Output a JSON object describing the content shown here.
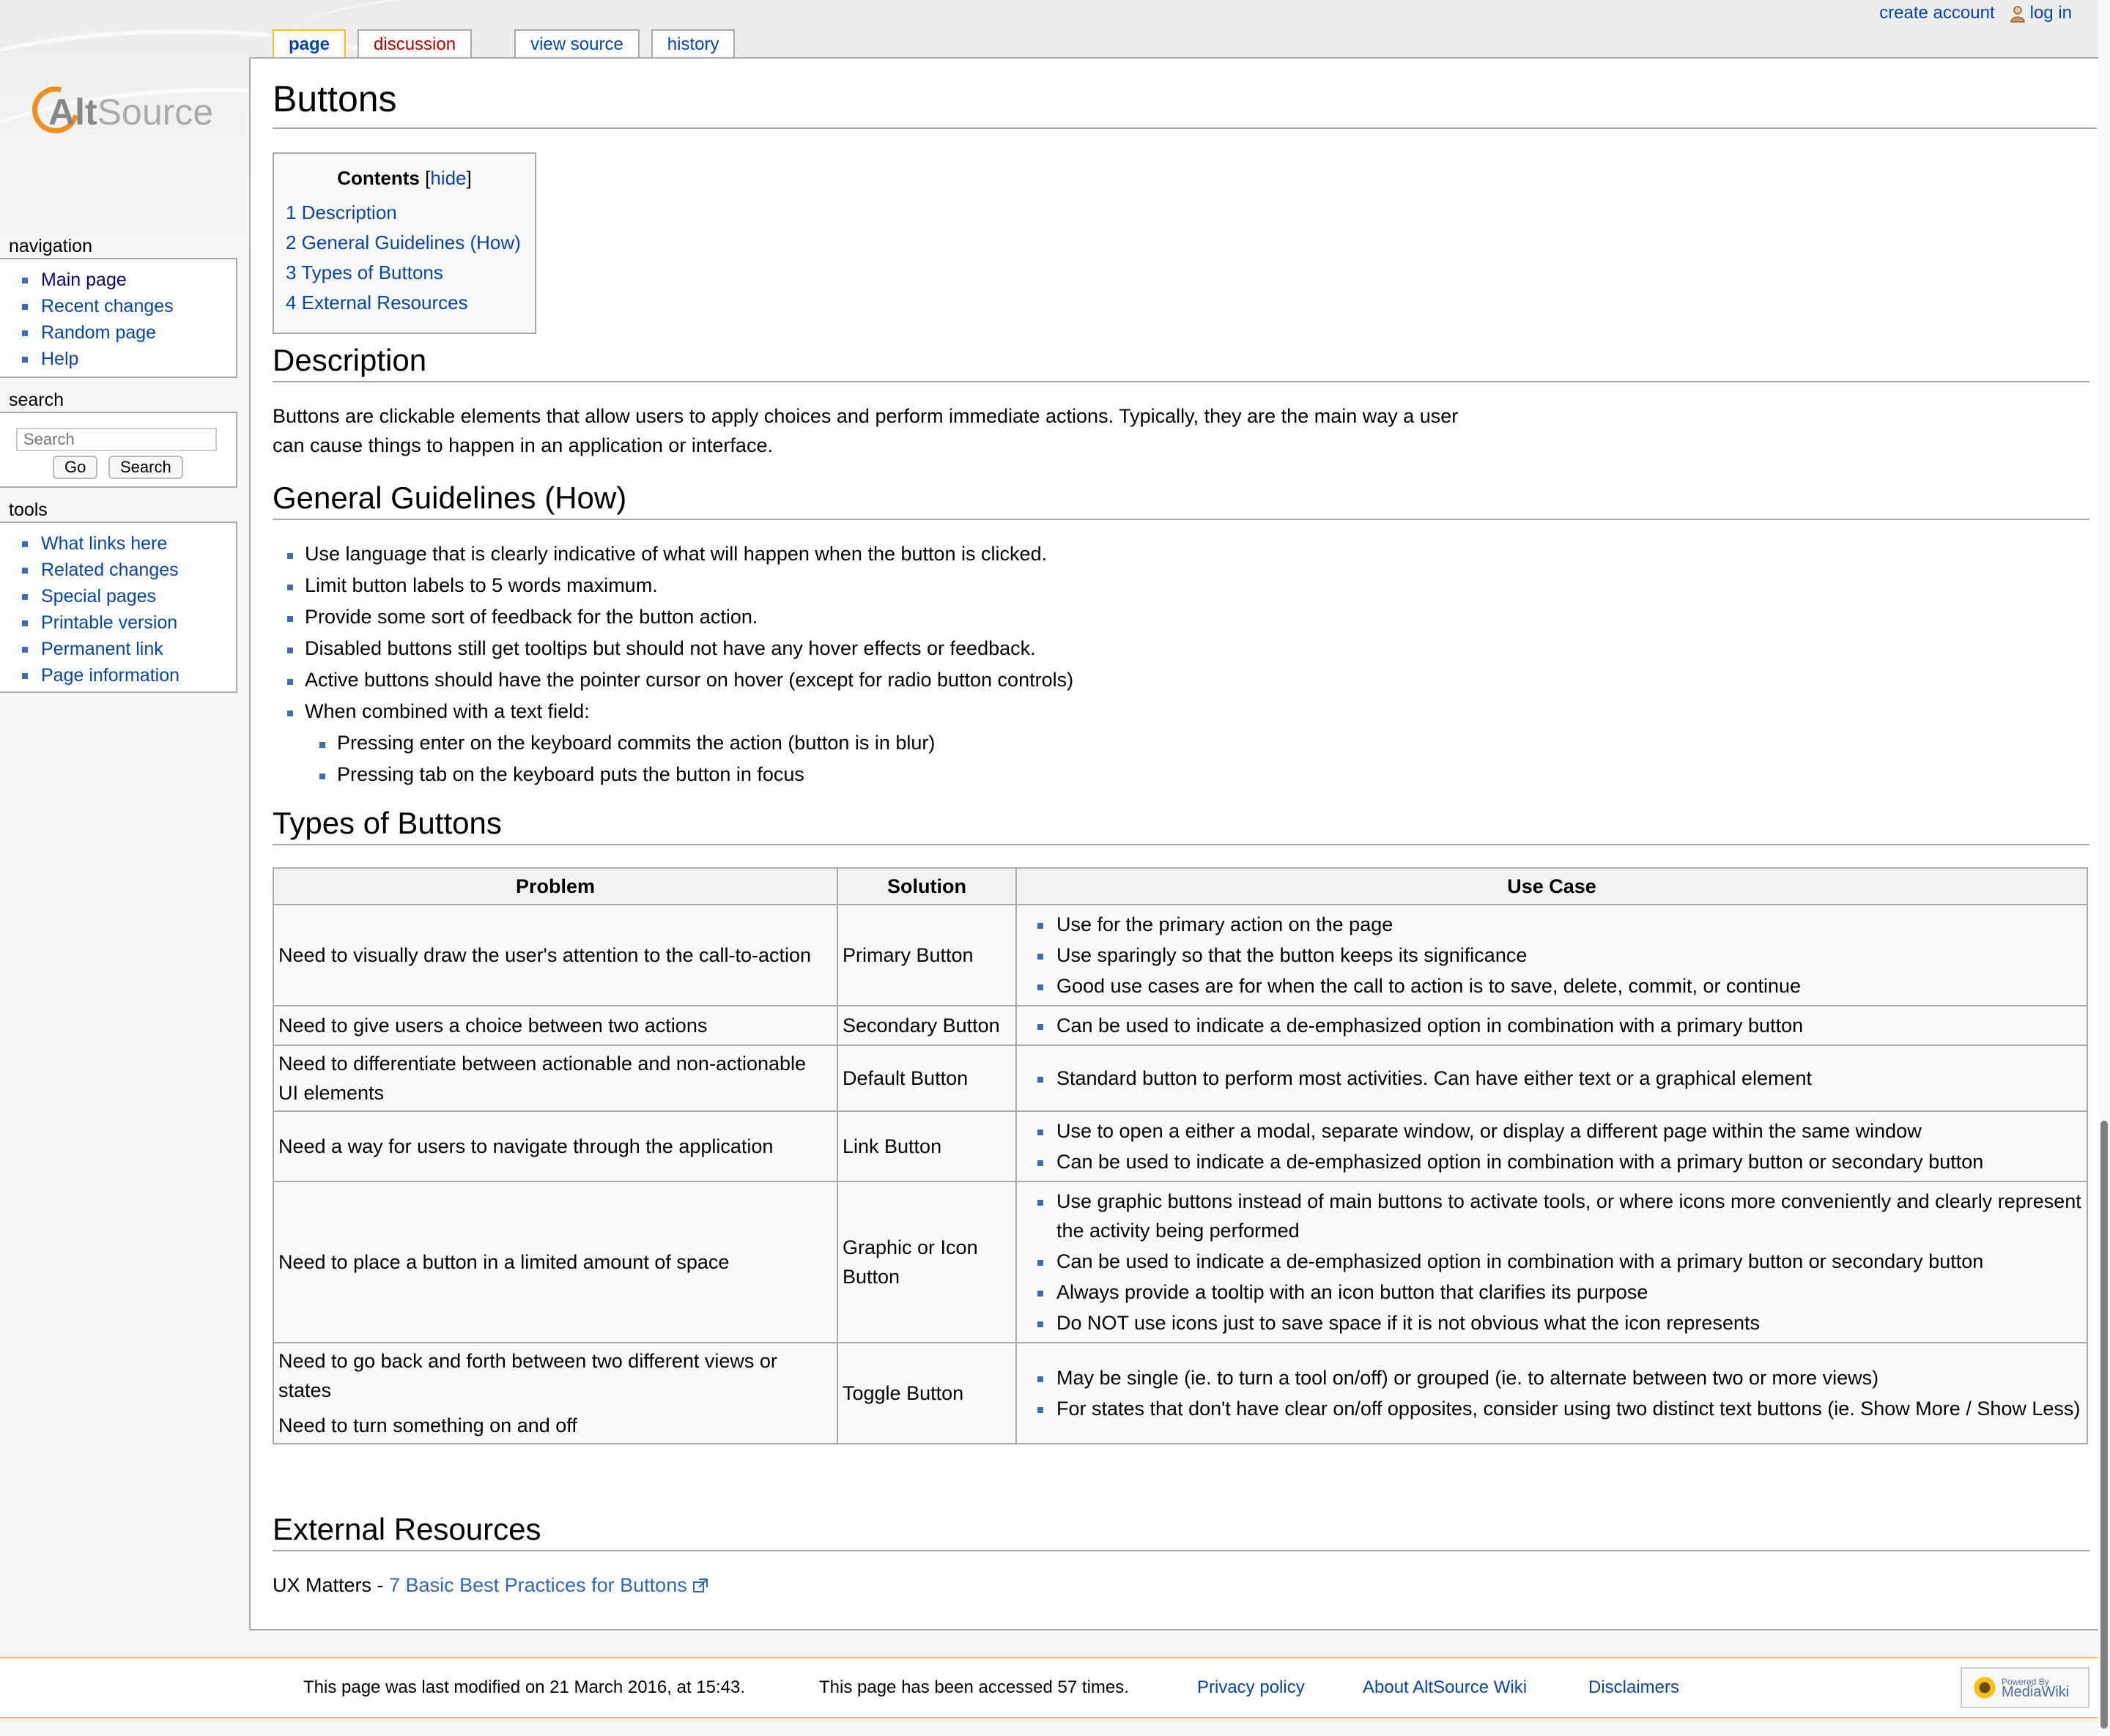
{
  "personal": {
    "create_account": "create account",
    "log_in": "log in"
  },
  "logo": {
    "part1": "Alt",
    "part2": "Source"
  },
  "tabs": [
    {
      "label": "page"
    },
    {
      "label": "discussion"
    },
    {
      "label": "view source"
    },
    {
      "label": "history"
    }
  ],
  "sidebar": {
    "navigation": {
      "heading": "navigation",
      "items": [
        "Main page",
        "Recent changes",
        "Random page",
        "Help"
      ]
    },
    "search": {
      "heading": "search",
      "placeholder": "Search",
      "go_label": "Go",
      "search_label": "Search"
    },
    "tools": {
      "heading": "tools",
      "items": [
        "What links here",
        "Related changes",
        "Special pages",
        "Printable version",
        "Permanent link",
        "Page information"
      ]
    }
  },
  "page": {
    "title": "Buttons",
    "toc": {
      "title": "Contents",
      "hide_label": "hide",
      "items": [
        "1 Description",
        "2 General Guidelines (How)",
        "3 Types of Buttons",
        "4 External Resources"
      ]
    },
    "description": {
      "heading": "Description",
      "line1": "Buttons are clickable elements that allow users to apply choices and perform immediate actions. Typically, they are the main way a user",
      "line2": "can cause things to happen in an application or interface."
    },
    "guidelines": {
      "heading": "General Guidelines (How)",
      "items": [
        "Use language that is clearly indicative of what will happen when the button is clicked.",
        "Limit button labels to 5 words maximum.",
        "Provide some sort of feedback for the button action.",
        "Disabled buttons still get tooltips but should not have any hover effects or feedback.",
        "Active buttons should have the pointer cursor on hover (except for radio button controls)",
        "When combined with a text field:"
      ],
      "subitems": [
        "Pressing enter on the keyboard commits the action (button is in blur)",
        "Pressing tab on the keyboard puts the button in focus"
      ]
    },
    "types": {
      "heading": "Types of Buttons",
      "headers": [
        "Problem",
        "Solution",
        "Use Case"
      ],
      "rows": [
        {
          "problem": [
            "Need to visually draw the user's attention to the call-to-action"
          ],
          "solution": "Primary Button",
          "use_cases": [
            "Use for the primary action on the page",
            "Use sparingly so that the button keeps its significance",
            "Good use cases are for when the call to action is to save, delete, commit, or continue"
          ]
        },
        {
          "problem": [
            "Need to give users a choice between two actions"
          ],
          "solution": "Secondary Button",
          "use_cases": [
            "Can be used to indicate a de-emphasized option in combination with a primary button"
          ]
        },
        {
          "problem": [
            "Need to differentiate between actionable and non-actionable UI elements"
          ],
          "solution": "Default Button",
          "use_cases": [
            "Standard button to perform most activities. Can have either text or a graphical element"
          ]
        },
        {
          "problem": [
            "Need a way for users to navigate through the application"
          ],
          "solution": "Link Button",
          "use_cases": [
            "Use to open a either a modal, separate window, or display a different page within the same window",
            "Can be used to indicate a de-emphasized option in combination with a primary button or secondary button"
          ]
        },
        {
          "problem": [
            "Need to place a button in a limited amount of space"
          ],
          "solution": "Graphic or Icon Button",
          "use_cases": [
            "Use graphic buttons instead of main buttons to activate tools, or where icons more conveniently and clearly represent the activity being performed",
            "Can be used to indicate a de-emphasized option in combination with a primary button or secondary button",
            "Always provide a tooltip with an icon button that clarifies its purpose",
            "Do NOT use icons just to save space if it is not obvious what the icon represents"
          ]
        },
        {
          "problem": [
            "Need to go back and forth between two different views or states",
            "Need to turn something on and off"
          ],
          "solution": "Toggle Button",
          "use_cases": [
            "May be single (ie. to turn a tool on/off) or grouped (ie. to alternate between two or more views)",
            "For states that don't have clear on/off opposites, consider using two distinct text buttons (ie. Show More / Show Less)"
          ]
        }
      ]
    },
    "external": {
      "heading": "External Resources",
      "prefix": "UX Matters - ",
      "link": "7 Basic Best Practices for Buttons"
    }
  },
  "footer": {
    "modified": "This page was last modified on 21 March 2016, at 15:43.",
    "accessed": "This page has been accessed 57 times.",
    "privacy": "Privacy policy",
    "about": "About AltSource Wiki",
    "disclaimers": "Disclaimers",
    "powered_small": "Powered By",
    "powered_big": "MediaWiki"
  },
  "colors": {
    "link": "#0645ad",
    "visited": "#0b0080",
    "new_link": "#ba0000",
    "tab_selected_border": "#fabd23",
    "bullet": "#3e6bb4",
    "logo_orange": "#f28e1c"
  },
  "icons": [
    "user-icon",
    "external-link-icon",
    "mediawiki-sunflower-icon"
  ]
}
